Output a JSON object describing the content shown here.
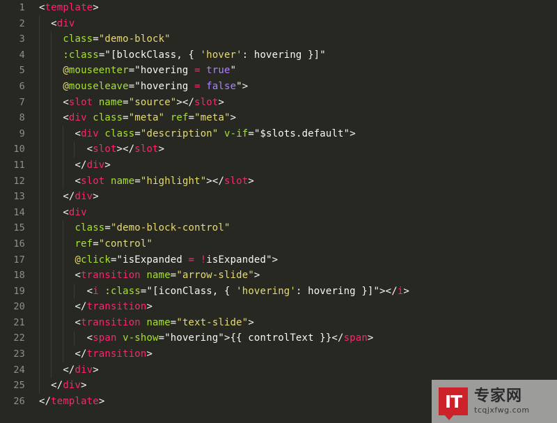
{
  "editor": {
    "language": "vue-html",
    "theme": "monokai",
    "background": "#272822",
    "gutter_color": "#8f908a",
    "first_line": 1,
    "last_line": 26,
    "line_numbers": [
      "1",
      "2",
      "3",
      "4",
      "5",
      "6",
      "7",
      "8",
      "9",
      "10",
      "11",
      "12",
      "13",
      "14",
      "15",
      "16",
      "17",
      "18",
      "19",
      "20",
      "21",
      "22",
      "23",
      "24",
      "25",
      "26"
    ],
    "colors": {
      "plain": "#f8f8f2",
      "tag": "#f92672",
      "attribute": "#a6e22e",
      "string": "#e6db74",
      "operator": "#f92672",
      "boolean": "#ae81ff",
      "indent_guide": "#3b3c35"
    },
    "lines": [
      {
        "n": "1",
        "indent": 0,
        "tokens": [
          {
            "c": "p",
            "x": "<"
          },
          {
            "c": "t",
            "x": "template"
          },
          {
            "c": "p",
            "x": ">"
          }
        ]
      },
      {
        "n": "2",
        "indent": 1,
        "tokens": [
          {
            "c": "p",
            "x": "  <"
          },
          {
            "c": "t",
            "x": "div"
          }
        ]
      },
      {
        "n": "3",
        "indent": 2,
        "tokens": [
          {
            "c": "a",
            "x": "    class"
          },
          {
            "c": "p",
            "x": "="
          },
          {
            "c": "s",
            "x": "\"demo-block\""
          }
        ]
      },
      {
        "n": "4",
        "indent": 2,
        "tokens": [
          {
            "c": "s",
            "x": "    :"
          },
          {
            "c": "a",
            "x": "class"
          },
          {
            "c": "p",
            "x": "=\"[blockClass, { "
          },
          {
            "c": "s",
            "x": "'hover'"
          },
          {
            "c": "p",
            "x": ": hovering }]\""
          }
        ]
      },
      {
        "n": "5",
        "indent": 2,
        "tokens": [
          {
            "c": "s",
            "x": "    @"
          },
          {
            "c": "a",
            "x": "mouseenter"
          },
          {
            "c": "p",
            "x": "=\"hovering "
          },
          {
            "c": "o",
            "x": "="
          },
          {
            "c": "p",
            "x": " "
          },
          {
            "c": "b",
            "x": "true"
          },
          {
            "c": "p",
            "x": "\""
          }
        ]
      },
      {
        "n": "6",
        "indent": 2,
        "tokens": [
          {
            "c": "s",
            "x": "    @"
          },
          {
            "c": "a",
            "x": "mouseleave"
          },
          {
            "c": "p",
            "x": "=\"hovering "
          },
          {
            "c": "o",
            "x": "="
          },
          {
            "c": "p",
            "x": " "
          },
          {
            "c": "b",
            "x": "false"
          },
          {
            "c": "p",
            "x": "\">"
          }
        ]
      },
      {
        "n": "7",
        "indent": 2,
        "tokens": [
          {
            "c": "p",
            "x": "    <"
          },
          {
            "c": "t",
            "x": "slot"
          },
          {
            "c": "p",
            "x": " "
          },
          {
            "c": "a",
            "x": "name"
          },
          {
            "c": "p",
            "x": "="
          },
          {
            "c": "s",
            "x": "\"source\""
          },
          {
            "c": "p",
            "x": "></"
          },
          {
            "c": "t",
            "x": "slot"
          },
          {
            "c": "p",
            "x": ">"
          }
        ]
      },
      {
        "n": "8",
        "indent": 2,
        "tokens": [
          {
            "c": "p",
            "x": "    <"
          },
          {
            "c": "t",
            "x": "div"
          },
          {
            "c": "p",
            "x": " "
          },
          {
            "c": "a",
            "x": "class"
          },
          {
            "c": "p",
            "x": "="
          },
          {
            "c": "s",
            "x": "\"meta\""
          },
          {
            "c": "p",
            "x": " "
          },
          {
            "c": "a",
            "x": "ref"
          },
          {
            "c": "p",
            "x": "="
          },
          {
            "c": "s",
            "x": "\"meta\""
          },
          {
            "c": "p",
            "x": ">"
          }
        ]
      },
      {
        "n": "9",
        "indent": 3,
        "tokens": [
          {
            "c": "p",
            "x": "      <"
          },
          {
            "c": "t",
            "x": "div"
          },
          {
            "c": "p",
            "x": " "
          },
          {
            "c": "a",
            "x": "class"
          },
          {
            "c": "p",
            "x": "="
          },
          {
            "c": "s",
            "x": "\"description\""
          },
          {
            "c": "p",
            "x": " "
          },
          {
            "c": "a",
            "x": "v-if"
          },
          {
            "c": "p",
            "x": "=\"$slots.default\">"
          }
        ]
      },
      {
        "n": "10",
        "indent": 4,
        "tokens": [
          {
            "c": "p",
            "x": "        <"
          },
          {
            "c": "t",
            "x": "slot"
          },
          {
            "c": "p",
            "x": "></"
          },
          {
            "c": "t",
            "x": "slot"
          },
          {
            "c": "p",
            "x": ">"
          }
        ]
      },
      {
        "n": "11",
        "indent": 3,
        "tokens": [
          {
            "c": "p",
            "x": "      </"
          },
          {
            "c": "t",
            "x": "div"
          },
          {
            "c": "p",
            "x": ">"
          }
        ]
      },
      {
        "n": "12",
        "indent": 3,
        "tokens": [
          {
            "c": "p",
            "x": "      <"
          },
          {
            "c": "t",
            "x": "slot"
          },
          {
            "c": "p",
            "x": " "
          },
          {
            "c": "a",
            "x": "name"
          },
          {
            "c": "p",
            "x": "="
          },
          {
            "c": "s",
            "x": "\"highlight\""
          },
          {
            "c": "p",
            "x": "></"
          },
          {
            "c": "t",
            "x": "slot"
          },
          {
            "c": "p",
            "x": ">"
          }
        ]
      },
      {
        "n": "13",
        "indent": 2,
        "tokens": [
          {
            "c": "p",
            "x": "    </"
          },
          {
            "c": "t",
            "x": "div"
          },
          {
            "c": "p",
            "x": ">"
          }
        ]
      },
      {
        "n": "14",
        "indent": 2,
        "tokens": [
          {
            "c": "p",
            "x": "    <"
          },
          {
            "c": "t",
            "x": "div"
          }
        ]
      },
      {
        "n": "15",
        "indent": 3,
        "tokens": [
          {
            "c": "a",
            "x": "      class"
          },
          {
            "c": "p",
            "x": "="
          },
          {
            "c": "s",
            "x": "\"demo-block-control\""
          }
        ]
      },
      {
        "n": "16",
        "indent": 3,
        "tokens": [
          {
            "c": "a",
            "x": "      ref"
          },
          {
            "c": "p",
            "x": "="
          },
          {
            "c": "s",
            "x": "\"control\""
          }
        ]
      },
      {
        "n": "17",
        "indent": 3,
        "tokens": [
          {
            "c": "s",
            "x": "      @"
          },
          {
            "c": "a",
            "x": "click"
          },
          {
            "c": "p",
            "x": "=\"isExpanded "
          },
          {
            "c": "o",
            "x": "="
          },
          {
            "c": "p",
            "x": " "
          },
          {
            "c": "o",
            "x": "!"
          },
          {
            "c": "p",
            "x": "isExpanded\">"
          }
        ]
      },
      {
        "n": "18",
        "indent": 3,
        "tokens": [
          {
            "c": "p",
            "x": "      <"
          },
          {
            "c": "t",
            "x": "transition"
          },
          {
            "c": "p",
            "x": " "
          },
          {
            "c": "a",
            "x": "name"
          },
          {
            "c": "p",
            "x": "="
          },
          {
            "c": "s",
            "x": "\"arrow-slide\""
          },
          {
            "c": "p",
            "x": ">"
          }
        ]
      },
      {
        "n": "19",
        "indent": 4,
        "tokens": [
          {
            "c": "p",
            "x": "        <"
          },
          {
            "c": "t",
            "x": "i"
          },
          {
            "c": "p",
            "x": " "
          },
          {
            "c": "s",
            "x": ":"
          },
          {
            "c": "a",
            "x": "class"
          },
          {
            "c": "p",
            "x": "=\"[iconClass, { "
          },
          {
            "c": "s",
            "x": "'hovering'"
          },
          {
            "c": "p",
            "x": ": hovering }]\"></"
          },
          {
            "c": "t",
            "x": "i"
          },
          {
            "c": "p",
            "x": ">"
          }
        ]
      },
      {
        "n": "20",
        "indent": 3,
        "tokens": [
          {
            "c": "p",
            "x": "      </"
          },
          {
            "c": "t",
            "x": "transition"
          },
          {
            "c": "p",
            "x": ">"
          }
        ]
      },
      {
        "n": "21",
        "indent": 3,
        "tokens": [
          {
            "c": "p",
            "x": "      <"
          },
          {
            "c": "t",
            "x": "transition"
          },
          {
            "c": "p",
            "x": " "
          },
          {
            "c": "a",
            "x": "name"
          },
          {
            "c": "p",
            "x": "="
          },
          {
            "c": "s",
            "x": "\"text-slide\""
          },
          {
            "c": "p",
            "x": ">"
          }
        ]
      },
      {
        "n": "22",
        "indent": 4,
        "tokens": [
          {
            "c": "p",
            "x": "        <"
          },
          {
            "c": "t",
            "x": "span"
          },
          {
            "c": "p",
            "x": " "
          },
          {
            "c": "a",
            "x": "v-show"
          },
          {
            "c": "p",
            "x": "=\"hovering\">{{ controlText }}</"
          },
          {
            "c": "t",
            "x": "span"
          },
          {
            "c": "p",
            "x": ">"
          }
        ]
      },
      {
        "n": "23",
        "indent": 3,
        "tokens": [
          {
            "c": "p",
            "x": "      </"
          },
          {
            "c": "t",
            "x": "transition"
          },
          {
            "c": "p",
            "x": ">"
          }
        ]
      },
      {
        "n": "24",
        "indent": 2,
        "tokens": [
          {
            "c": "p",
            "x": "    </"
          },
          {
            "c": "t",
            "x": "div"
          },
          {
            "c": "p",
            "x": ">"
          }
        ]
      },
      {
        "n": "25",
        "indent": 1,
        "tokens": [
          {
            "c": "p",
            "x": "  </"
          },
          {
            "c": "t",
            "x": "div"
          },
          {
            "c": "p",
            "x": ">"
          }
        ]
      },
      {
        "n": "26",
        "indent": 0,
        "tokens": [
          {
            "c": "p",
            "x": "</"
          },
          {
            "c": "t",
            "x": "template"
          },
          {
            "c": "p",
            "x": ">"
          }
        ]
      }
    ]
  },
  "watermark": {
    "logo_text": "IT",
    "cn_text": "专家网",
    "url_text": "tcqjxfwg.com",
    "logo_color": "#cc2229"
  }
}
